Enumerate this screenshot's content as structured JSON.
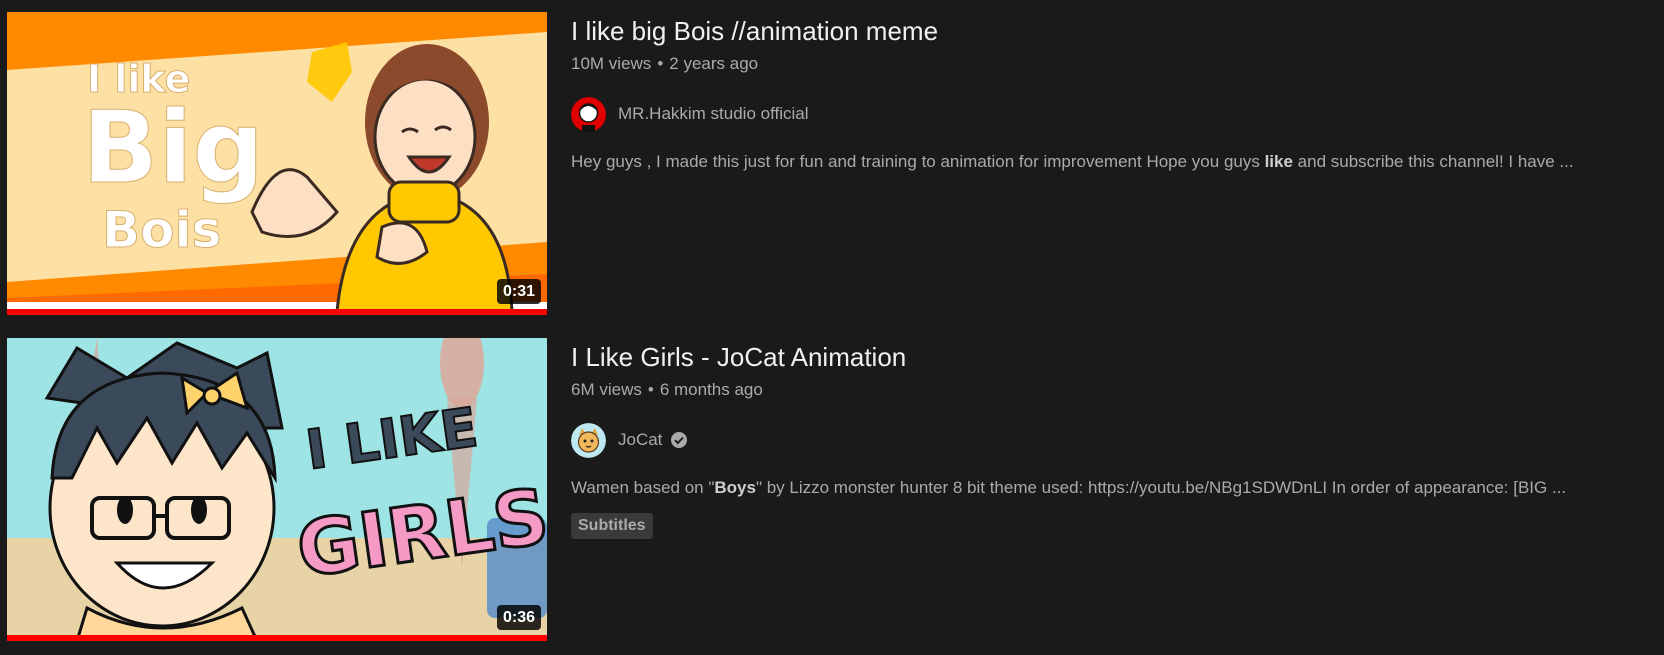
{
  "results": [
    {
      "title": "I like big Bois //animation meme",
      "views": "10M views",
      "age": "2 years ago",
      "channel": "MR.Hakkim studio official",
      "verified": false,
      "desc_parts": [
        "Hey guys , I made this just for fun and training to animation for improvement Hope you guys ",
        "like",
        " and subscribe this channel! I have ..."
      ],
      "duration": "0:31",
      "watched_fraction": 1.0,
      "thumbnail_text": [
        "I like",
        "Big",
        "Bois"
      ]
    },
    {
      "title": "I Like Girls - JoCat Animation",
      "views": "6M views",
      "age": "6 months ago",
      "channel": "JoCat",
      "verified": true,
      "desc_parts": [
        "Wamen based on \"",
        "Boys",
        "\" by Lizzo monster hunter 8 bit theme used: https://youtu.be/NBg1SDWDnLI In order of appearance: [BIG ..."
      ],
      "badge": "Subtitles",
      "duration": "0:36",
      "watched_fraction": 1.0,
      "thumbnail_text": [
        "I LIKE",
        "GIRLS"
      ]
    }
  ],
  "separator": "•",
  "colors": {
    "background": "#1a1a1a",
    "title": "#f1f1f1",
    "secondary": "#aaaaaa",
    "progress": "#ff0000"
  }
}
